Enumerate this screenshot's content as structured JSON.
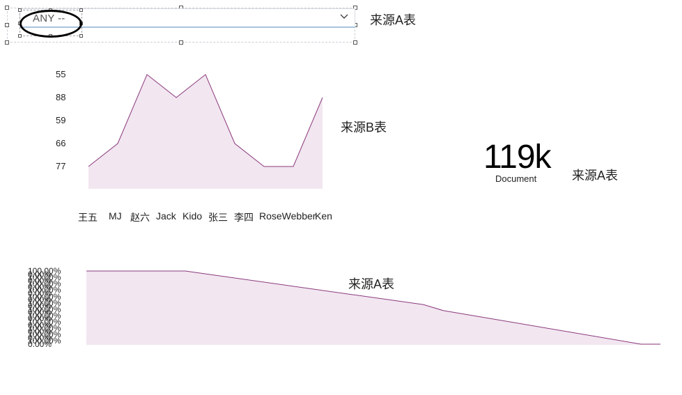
{
  "dropdown": {
    "value": "ANY --",
    "caret_icon": "chevron-down-icon"
  },
  "sources": {
    "dropdown": "来源A表",
    "line_chart": "来源B表",
    "kpi": "来源A表",
    "area_chart": "来源A表"
  },
  "kpi": {
    "value": "119k",
    "caption": "Document"
  },
  "chart_data": [
    {
      "type": "area",
      "categories": [
        "王五",
        "MJ",
        "赵六",
        "Jack",
        "Kido",
        "张三",
        "李四",
        "RoseWebber",
        "Ken"
      ],
      "y_tick_labels": [
        "55",
        "88",
        "59",
        "66",
        "77"
      ],
      "series": [
        {
          "values": [
            77,
            66,
            55,
            88,
            55,
            66,
            77,
            77,
            88
          ]
        }
      ],
      "color": "#8b3a7d",
      "fill": "#f2e6f0"
    },
    {
      "type": "area",
      "y_tick_labels": [
        "100.00%",
        "0.00%"
      ],
      "series": [
        {
          "values": [
            100,
            100,
            100,
            100,
            100,
            54,
            46,
            0,
            0
          ]
        }
      ],
      "ylim": [
        0,
        100
      ],
      "color": "#8b3a7d",
      "fill": "#f2e6f0"
    }
  ]
}
